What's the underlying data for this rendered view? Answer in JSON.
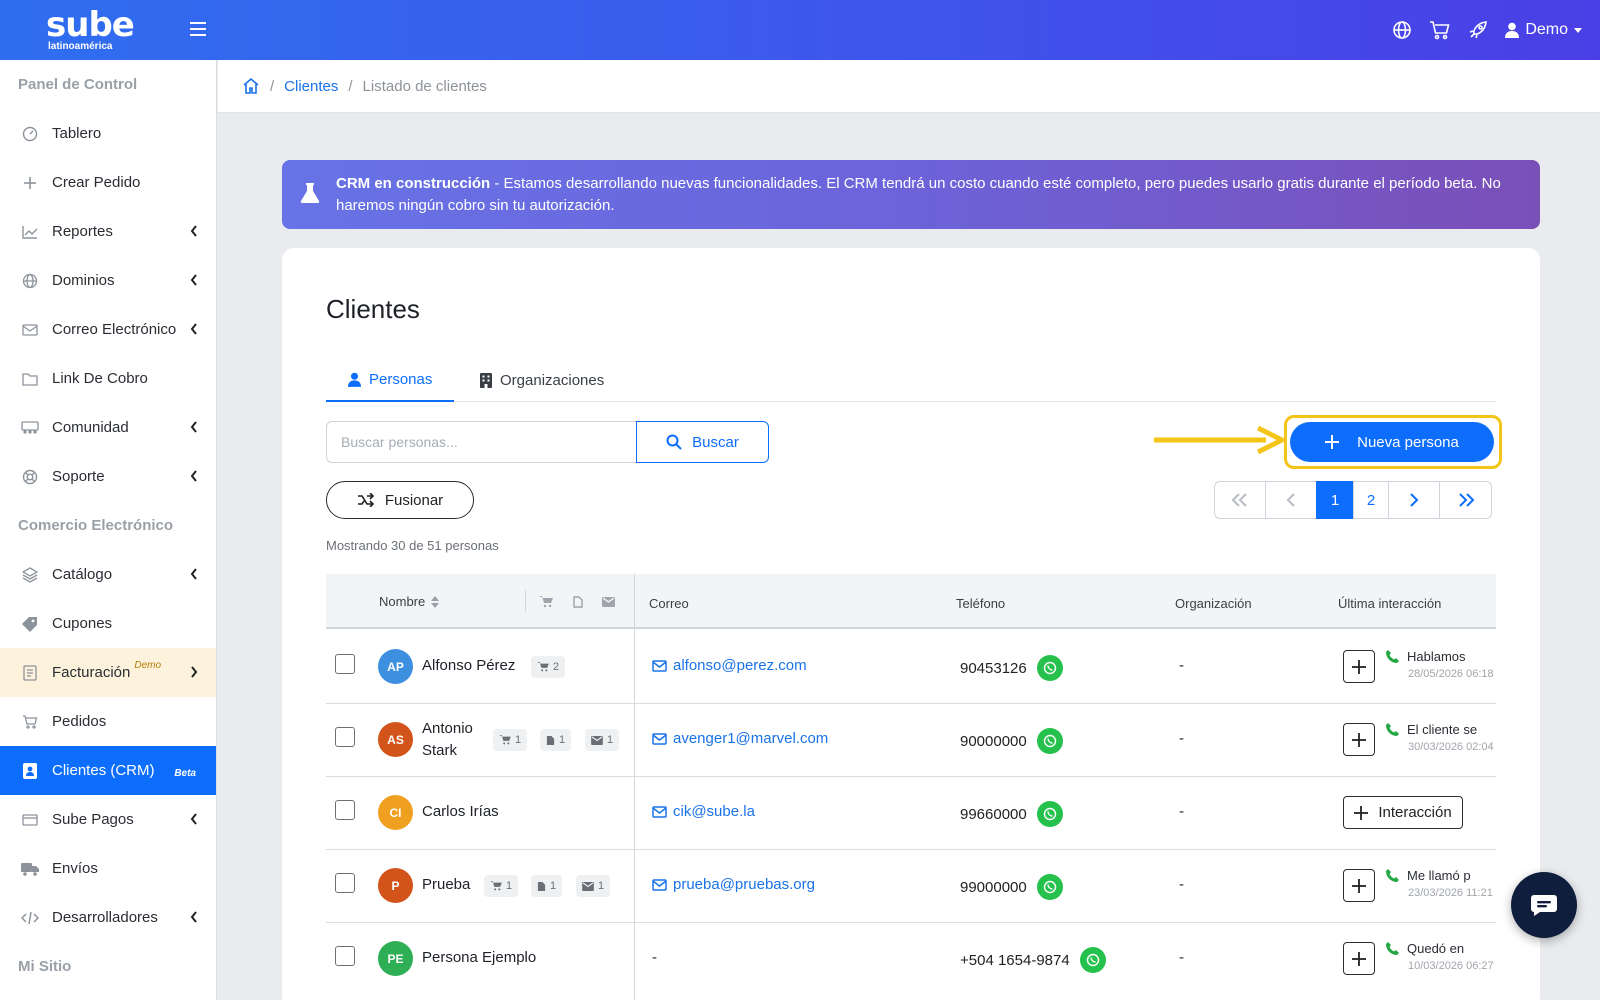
{
  "header": {
    "logo_main": "sube",
    "logo_sub": "latinoamérica",
    "user_label": "Demo",
    "icons": [
      "globe-icon",
      "cart-icon",
      "rocket-icon",
      "user-icon"
    ]
  },
  "sidebar": {
    "section1": "Panel de Control",
    "tablero": "Tablero",
    "crear_pedido": "Crear Pedido",
    "reportes": "Reportes",
    "dominios": "Dominios",
    "correo": "Correo Electrónico",
    "link_cobro": "Link De Cobro",
    "comunidad": "Comunidad",
    "soporte": "Soporte",
    "section2": "Comercio Electrónico",
    "catalogo": "Catálogo",
    "cupones": "Cupones",
    "facturacion": "Facturación",
    "facturacion_badge": "Demo",
    "pedidos": "Pedidos",
    "clientes": "Clientes (CRM)",
    "clientes_badge": "Beta",
    "sube_pagos": "Sube Pagos",
    "envios": "Envíos",
    "desarrolladores": "Desarrolladores",
    "section3": "Mi Sitio"
  },
  "breadcrumb": {
    "clientes": "Clientes",
    "current": "Listado de clientes"
  },
  "banner": {
    "title": "CRM en construcción",
    "text": " - Estamos desarrollando nuevas funcionalidades. El CRM tendrá un costo cuando esté completo, pero puedes usarlo gratis durante el período beta. No haremos ningún cobro sin tu autorización."
  },
  "main": {
    "title": "Clientes",
    "tabs": {
      "personas": "Personas",
      "organizaciones": "Organizaciones"
    },
    "search_placeholder": "Buscar personas...",
    "search_label": "Buscar",
    "fusion_label": "Fusionar",
    "new_label": "Nueva persona",
    "summary": "Mostrando 30 de 51 personas",
    "pager": {
      "page1": "1",
      "page2": "2"
    },
    "accent_color": "#0d6efd",
    "highlight_color": "#f4c518"
  },
  "table": {
    "columns": {
      "nombre": "Nombre",
      "correo": "Correo",
      "telefono": "Teléfono",
      "organizacion": "Organización",
      "ultima": "Última interacción"
    },
    "interaction_button": "Interacción",
    "rows": [
      {
        "initials": "AP",
        "color": "#3d8fe0",
        "name": "Alfonso Pérez",
        "name2": "",
        "cart": "2",
        "docs": "",
        "mails": "",
        "email": "alfonso@perez.com",
        "phone": "90453126",
        "org": "-",
        "last_text": "Hablamos",
        "last_date": "28/05/2026 06:18"
      },
      {
        "initials": "AS",
        "color": "#d3541a",
        "name": "Antonio",
        "name2": "Stark",
        "cart": "1",
        "docs": "1",
        "mails": "1",
        "email": "avenger1@marvel.com",
        "phone": "90000000",
        "org": "-",
        "last_text": "El cliente se",
        "last_date": "30/03/2026 02:04"
      },
      {
        "initials": "CI",
        "color": "#f0a020",
        "name": "Carlos Irías",
        "name2": "",
        "cart": "",
        "docs": "",
        "mails": "",
        "email": "cik@sube.la",
        "phone": "99660000",
        "org": "-",
        "last_text": "",
        "last_date": ""
      },
      {
        "initials": "P",
        "color": "#d3541a",
        "name": "Prueba",
        "name2": "",
        "cart": "1",
        "docs": "1",
        "mails": "1",
        "email": "prueba@pruebas.org",
        "phone": "99000000",
        "org": "-",
        "last_text": "Me llamó p",
        "last_date": "23/03/2026 11:21"
      },
      {
        "initials": "PE",
        "color": "#2eae55",
        "name": "Persona Ejemplo",
        "name2": "",
        "cart": "",
        "docs": "",
        "mails": "",
        "email": "-",
        "phone": "+504 1654-9874",
        "org": "-",
        "last_text": "Quedó en",
        "last_date": "10/03/2026 06:27"
      }
    ]
  }
}
